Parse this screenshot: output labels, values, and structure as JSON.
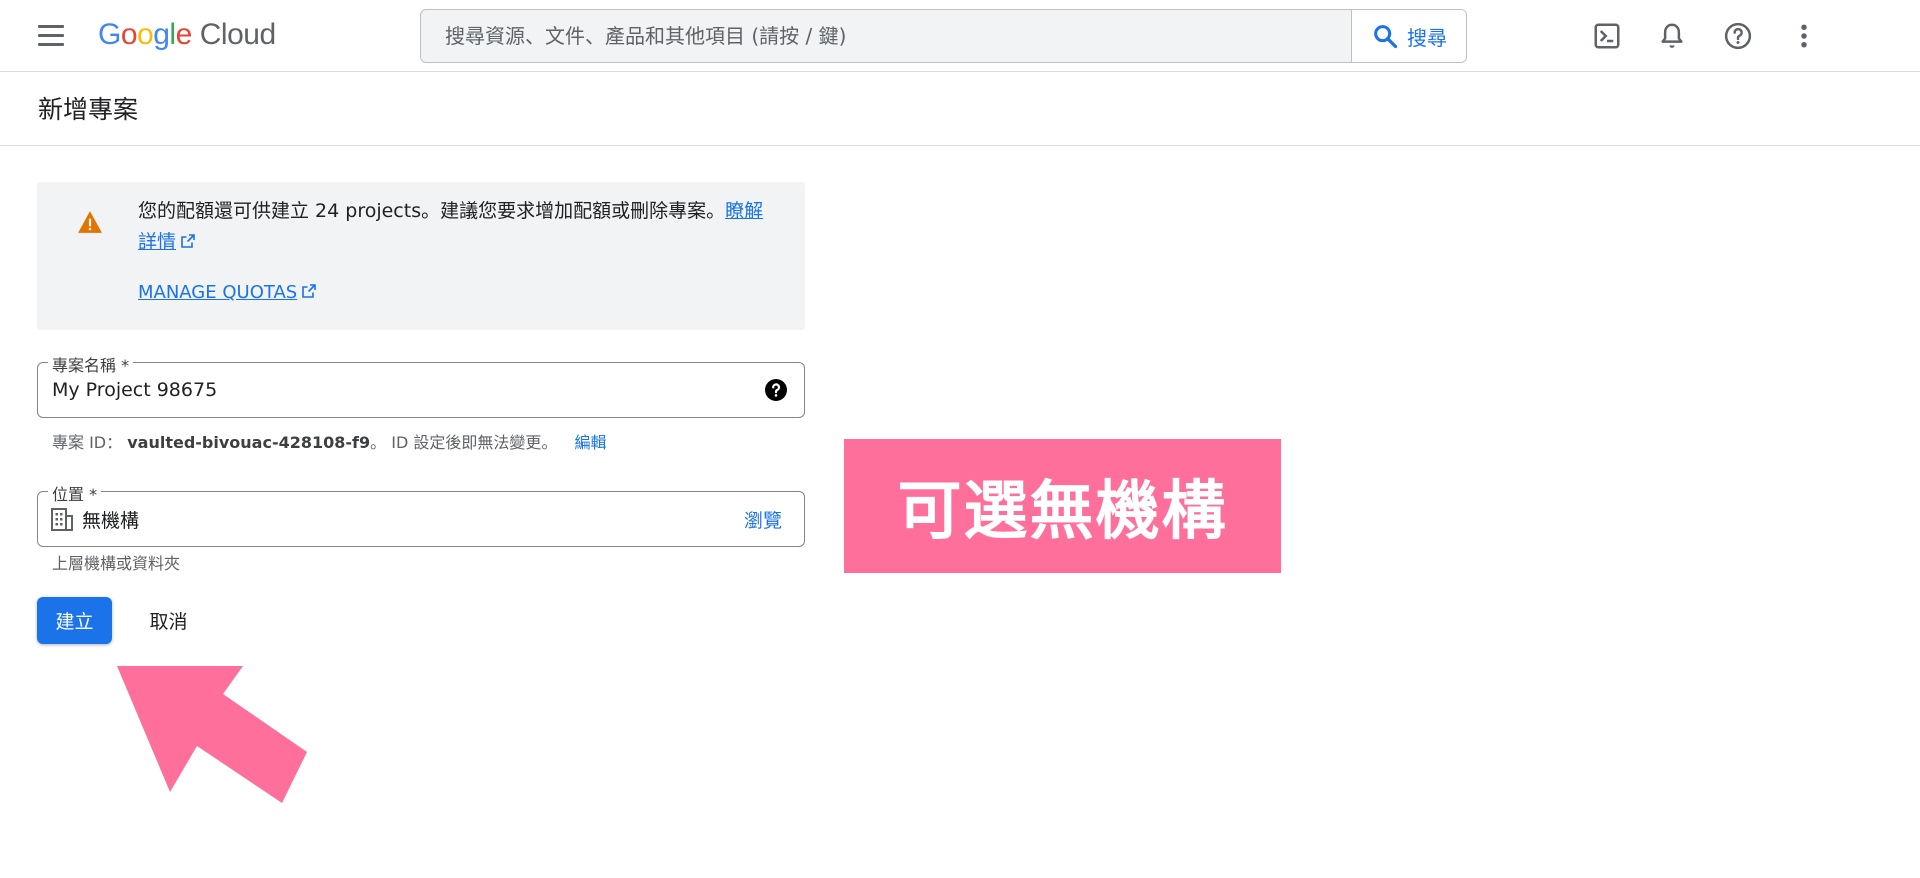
{
  "header": {
    "logo_google": [
      "G",
      "o",
      "o",
      "g",
      "l",
      "e"
    ],
    "logo_cloud": "Cloud",
    "search_placeholder": "搜尋資源、文件、產品和其他項目 (請按 / 鍵)",
    "search_button": "搜尋",
    "icons": [
      "menu-icon",
      "terminal-icon",
      "bell-icon",
      "help-icon",
      "more-vert-icon"
    ]
  },
  "page": {
    "title": "新增專案"
  },
  "banner": {
    "message": "您的配額還可供建立 24 projects。建議您要求增加配額或刪除專案。",
    "learn_more": "瞭解詳情",
    "manage_quotas": "MANAGE QUOTAS"
  },
  "form": {
    "project_name_label": "專案名稱 *",
    "project_name_value": "My Project 98675",
    "project_id_prefix": "專案 ID：",
    "project_id": "vaulted-bivouac-428108-f9",
    "project_id_note": "。 ID 設定後即無法變更。",
    "edit_link": "編輯",
    "location_label": "位置 *",
    "location_value": "無機構",
    "browse": "瀏覽",
    "location_hint": "上層機構或資料夾"
  },
  "actions": {
    "create": "建立",
    "cancel": "取消"
  },
  "annotation": {
    "callout_text": "可選無機構",
    "color": "#ff6f9c"
  },
  "colors": {
    "accent": "#1a73e8",
    "warning": "#e37400"
  }
}
